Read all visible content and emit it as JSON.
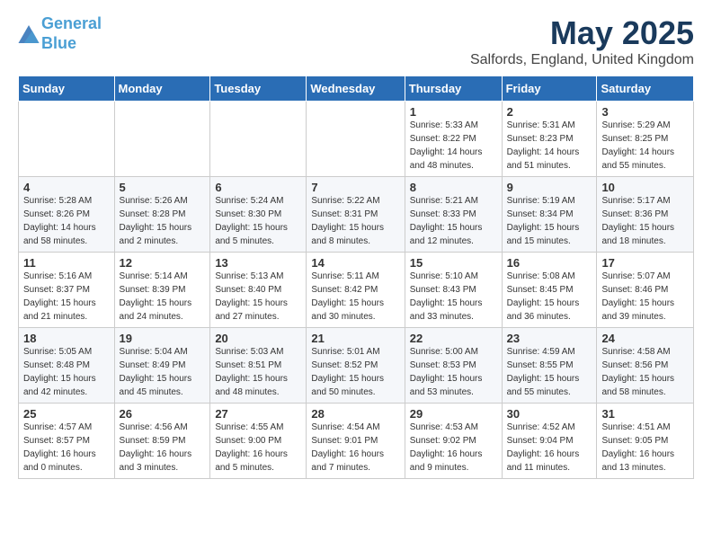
{
  "header": {
    "logo_line1": "General",
    "logo_line2": "Blue",
    "title": "May 2025",
    "location": "Salfords, England, United Kingdom"
  },
  "weekdays": [
    "Sunday",
    "Monday",
    "Tuesday",
    "Wednesday",
    "Thursday",
    "Friday",
    "Saturday"
  ],
  "weeks": [
    [
      {
        "day": "",
        "info": ""
      },
      {
        "day": "",
        "info": ""
      },
      {
        "day": "",
        "info": ""
      },
      {
        "day": "",
        "info": ""
      },
      {
        "day": "1",
        "info": "Sunrise: 5:33 AM\nSunset: 8:22 PM\nDaylight: 14 hours\nand 48 minutes."
      },
      {
        "day": "2",
        "info": "Sunrise: 5:31 AM\nSunset: 8:23 PM\nDaylight: 14 hours\nand 51 minutes."
      },
      {
        "day": "3",
        "info": "Sunrise: 5:29 AM\nSunset: 8:25 PM\nDaylight: 14 hours\nand 55 minutes."
      }
    ],
    [
      {
        "day": "4",
        "info": "Sunrise: 5:28 AM\nSunset: 8:26 PM\nDaylight: 14 hours\nand 58 minutes."
      },
      {
        "day": "5",
        "info": "Sunrise: 5:26 AM\nSunset: 8:28 PM\nDaylight: 15 hours\nand 2 minutes."
      },
      {
        "day": "6",
        "info": "Sunrise: 5:24 AM\nSunset: 8:30 PM\nDaylight: 15 hours\nand 5 minutes."
      },
      {
        "day": "7",
        "info": "Sunrise: 5:22 AM\nSunset: 8:31 PM\nDaylight: 15 hours\nand 8 minutes."
      },
      {
        "day": "8",
        "info": "Sunrise: 5:21 AM\nSunset: 8:33 PM\nDaylight: 15 hours\nand 12 minutes."
      },
      {
        "day": "9",
        "info": "Sunrise: 5:19 AM\nSunset: 8:34 PM\nDaylight: 15 hours\nand 15 minutes."
      },
      {
        "day": "10",
        "info": "Sunrise: 5:17 AM\nSunset: 8:36 PM\nDaylight: 15 hours\nand 18 minutes."
      }
    ],
    [
      {
        "day": "11",
        "info": "Sunrise: 5:16 AM\nSunset: 8:37 PM\nDaylight: 15 hours\nand 21 minutes."
      },
      {
        "day": "12",
        "info": "Sunrise: 5:14 AM\nSunset: 8:39 PM\nDaylight: 15 hours\nand 24 minutes."
      },
      {
        "day": "13",
        "info": "Sunrise: 5:13 AM\nSunset: 8:40 PM\nDaylight: 15 hours\nand 27 minutes."
      },
      {
        "day": "14",
        "info": "Sunrise: 5:11 AM\nSunset: 8:42 PM\nDaylight: 15 hours\nand 30 minutes."
      },
      {
        "day": "15",
        "info": "Sunrise: 5:10 AM\nSunset: 8:43 PM\nDaylight: 15 hours\nand 33 minutes."
      },
      {
        "day": "16",
        "info": "Sunrise: 5:08 AM\nSunset: 8:45 PM\nDaylight: 15 hours\nand 36 minutes."
      },
      {
        "day": "17",
        "info": "Sunrise: 5:07 AM\nSunset: 8:46 PM\nDaylight: 15 hours\nand 39 minutes."
      }
    ],
    [
      {
        "day": "18",
        "info": "Sunrise: 5:05 AM\nSunset: 8:48 PM\nDaylight: 15 hours\nand 42 minutes."
      },
      {
        "day": "19",
        "info": "Sunrise: 5:04 AM\nSunset: 8:49 PM\nDaylight: 15 hours\nand 45 minutes."
      },
      {
        "day": "20",
        "info": "Sunrise: 5:03 AM\nSunset: 8:51 PM\nDaylight: 15 hours\nand 48 minutes."
      },
      {
        "day": "21",
        "info": "Sunrise: 5:01 AM\nSunset: 8:52 PM\nDaylight: 15 hours\nand 50 minutes."
      },
      {
        "day": "22",
        "info": "Sunrise: 5:00 AM\nSunset: 8:53 PM\nDaylight: 15 hours\nand 53 minutes."
      },
      {
        "day": "23",
        "info": "Sunrise: 4:59 AM\nSunset: 8:55 PM\nDaylight: 15 hours\nand 55 minutes."
      },
      {
        "day": "24",
        "info": "Sunrise: 4:58 AM\nSunset: 8:56 PM\nDaylight: 15 hours\nand 58 minutes."
      }
    ],
    [
      {
        "day": "25",
        "info": "Sunrise: 4:57 AM\nSunset: 8:57 PM\nDaylight: 16 hours\nand 0 minutes."
      },
      {
        "day": "26",
        "info": "Sunrise: 4:56 AM\nSunset: 8:59 PM\nDaylight: 16 hours\nand 3 minutes."
      },
      {
        "day": "27",
        "info": "Sunrise: 4:55 AM\nSunset: 9:00 PM\nDaylight: 16 hours\nand 5 minutes."
      },
      {
        "day": "28",
        "info": "Sunrise: 4:54 AM\nSunset: 9:01 PM\nDaylight: 16 hours\nand 7 minutes."
      },
      {
        "day": "29",
        "info": "Sunrise: 4:53 AM\nSunset: 9:02 PM\nDaylight: 16 hours\nand 9 minutes."
      },
      {
        "day": "30",
        "info": "Sunrise: 4:52 AM\nSunset: 9:04 PM\nDaylight: 16 hours\nand 11 minutes."
      },
      {
        "day": "31",
        "info": "Sunrise: 4:51 AM\nSunset: 9:05 PM\nDaylight: 16 hours\nand 13 minutes."
      }
    ]
  ]
}
